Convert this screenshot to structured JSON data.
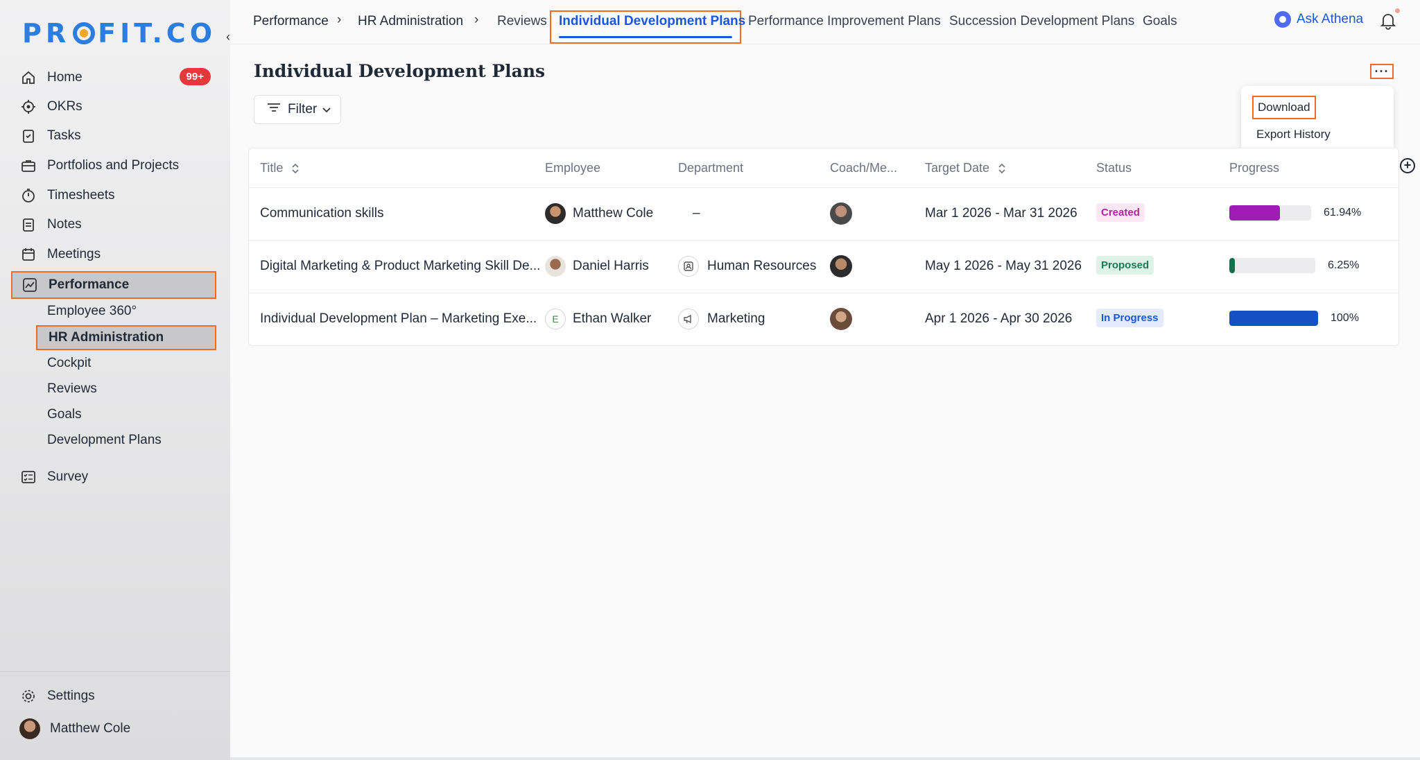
{
  "brand": {
    "logo_text_left": "PR",
    "logo_text_right": "FIT.CO"
  },
  "sidebar": {
    "items": [
      {
        "label": "Home",
        "icon": "home-icon",
        "badge": "99+"
      },
      {
        "label": "OKRs",
        "icon": "target-icon"
      },
      {
        "label": "Tasks",
        "icon": "clipboard-check-icon"
      },
      {
        "label": "Portfolios and Projects",
        "icon": "briefcase-icon"
      },
      {
        "label": "Timesheets",
        "icon": "stopwatch-icon"
      },
      {
        "label": "Notes",
        "icon": "notes-icon"
      },
      {
        "label": "Meetings",
        "icon": "calendar-icon"
      },
      {
        "label": "Performance",
        "icon": "chart-line-icon"
      }
    ],
    "performance_sub": [
      {
        "label": "Employee 360°"
      },
      {
        "label": "HR Administration"
      },
      {
        "label": "Cockpit"
      },
      {
        "label": "Reviews"
      },
      {
        "label": "Goals"
      },
      {
        "label": "Development Plans"
      }
    ],
    "survey": {
      "label": "Survey",
      "icon": "survey-icon"
    },
    "settings": {
      "label": "Settings",
      "icon": "gear-icon"
    },
    "user": {
      "name": "Matthew Cole"
    }
  },
  "topnav": {
    "breadcrumbs": [
      "Performance",
      "HR Administration"
    ],
    "separator": "›",
    "tabs": [
      "Reviews",
      "Individual Development Plans",
      "Performance Improvement Plans",
      "Succession Development Plans",
      "Goals"
    ],
    "active_tab": "Individual Development Plans",
    "ask_label": "Ask Athena"
  },
  "page": {
    "title": "Individual Development Plans",
    "filter_label": "Filter",
    "more_label": "···"
  },
  "menu": {
    "items": [
      "Download",
      "Export History"
    ]
  },
  "table": {
    "columns": [
      "Title",
      "Employee",
      "Department",
      "Coach/Me...",
      "Target Date",
      "Status",
      "Progress"
    ],
    "rows": [
      {
        "title": "Communication skills",
        "employee": "Matthew Cole",
        "department": "–",
        "target_date": "Mar 1 2026 - Mar 31 2026",
        "status": "Created",
        "progress_label": "61.94%",
        "progress": 0.6194
      },
      {
        "title": "Digital Marketing & Product Marketing Skill De...",
        "employee": "Daniel Harris",
        "department": "Human Resources",
        "target_date": "May 1 2026 - May 31 2026",
        "status": "Proposed",
        "progress_label": "6.25%",
        "progress": 0.0625
      },
      {
        "title": "Individual Development Plan – Marketing Exe...",
        "employee": "Ethan Walker",
        "employee_initial": "E",
        "department": "Marketing",
        "target_date": "Apr 1 2026 - Apr 30 2026",
        "status": "In Progress",
        "progress_label": "100%",
        "progress": 1.0
      }
    ]
  },
  "colors": {
    "accent": "#1a56db",
    "highlight_border": "#f26b21",
    "status_created_bg": "#fde7f5",
    "status_created_fg": "#b0259d",
    "status_proposed_bg": "#ddf3ea",
    "status_proposed_fg": "#1a7a55",
    "status_inprogress_bg": "#e4ecfb",
    "status_inprogress_fg": "#1a56db",
    "progress_1": "#a01ab8",
    "progress_2": "#1b6b4d",
    "progress_3": "#1550c4"
  }
}
